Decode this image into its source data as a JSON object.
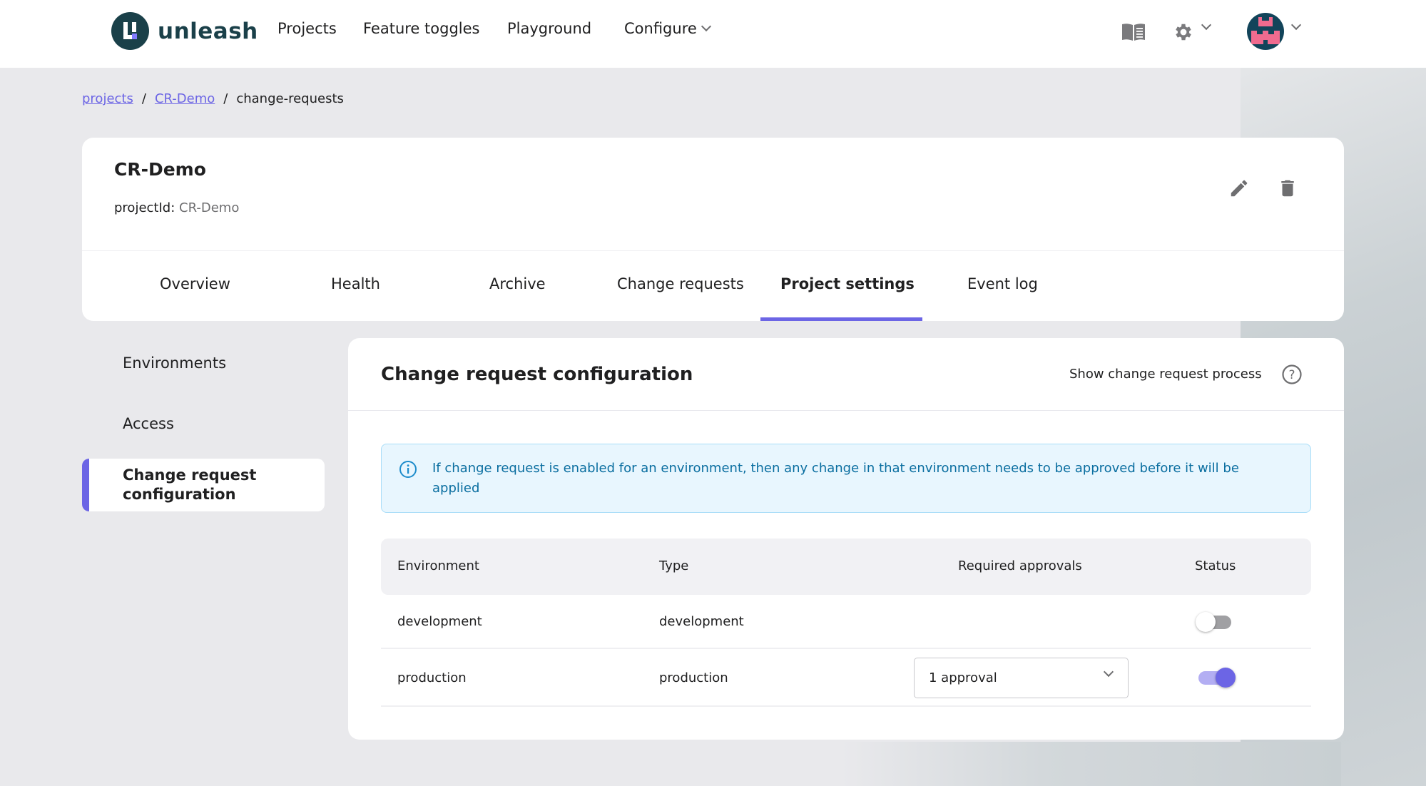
{
  "app": {
    "name": "unleash"
  },
  "nav": {
    "items": [
      {
        "label": "Projects"
      },
      {
        "label": "Feature toggles"
      },
      {
        "label": "Playground"
      },
      {
        "label": "Configure",
        "has_dropdown": true
      }
    ],
    "right_icons": [
      "docs-icon",
      "settings-icon",
      "avatar"
    ]
  },
  "breadcrumb": {
    "items": [
      {
        "label": "projects",
        "link": true
      },
      {
        "label": "CR-Demo",
        "link": true
      },
      {
        "label": "change-requests",
        "link": false
      }
    ],
    "separator": "/"
  },
  "project": {
    "title": "CR-Demo",
    "id_label": "projectId:",
    "id_value": "CR-Demo",
    "tabs": [
      {
        "label": "Overview",
        "active": false
      },
      {
        "label": "Health",
        "active": false
      },
      {
        "label": "Archive",
        "active": false
      },
      {
        "label": "Change requests",
        "active": false
      },
      {
        "label": "Project settings",
        "active": true
      },
      {
        "label": "Event log",
        "active": false
      }
    ]
  },
  "sidebar": {
    "items": [
      {
        "label": "Environments",
        "active": false
      },
      {
        "label": "Access",
        "active": false
      },
      {
        "label": "Change request configuration",
        "active": true
      }
    ]
  },
  "main": {
    "title": "Change request configuration",
    "show_process_label": "Show change request process",
    "info_text": "If change request is enabled for an environment, then any change in that environment needs to be approved before it will be applied",
    "table": {
      "columns": [
        "Environment",
        "Type",
        "Required approvals",
        "Status"
      ],
      "rows": [
        {
          "environment": "development",
          "type": "development",
          "required_approvals": null,
          "enabled": false
        },
        {
          "environment": "production",
          "type": "production",
          "required_approvals": "1 approval",
          "enabled": true
        }
      ]
    }
  },
  "colors": {
    "accent": "#6c65e5",
    "brand_dark": "#1a4049",
    "info_bg": "#e8f6fe",
    "info_text": "#0a6ea0",
    "page_bg": "#e9e9ec"
  }
}
